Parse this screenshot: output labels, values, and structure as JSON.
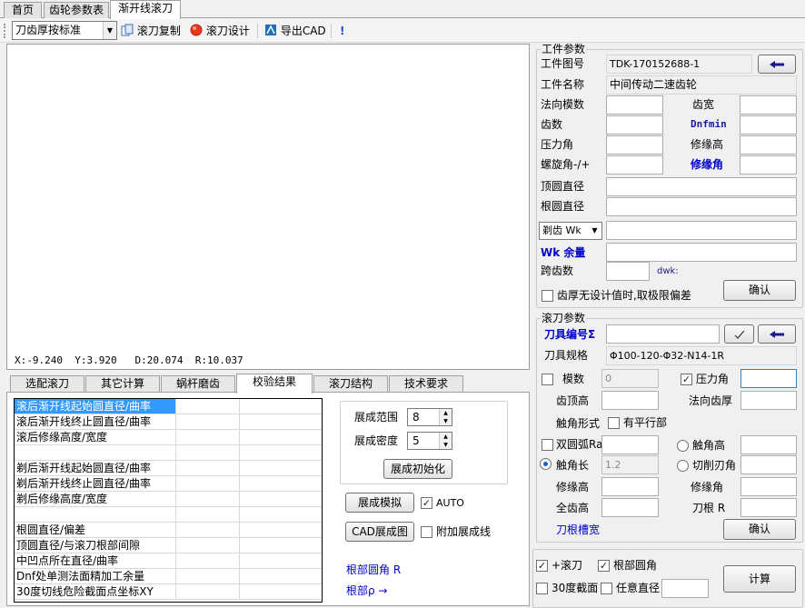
{
  "tabs": {
    "home": "首页",
    "gear_table": "齿轮参数表",
    "hob": "渐开线滚刀"
  },
  "toolbar": {
    "mode": "刀齿厚按标准",
    "copy": "滚刀复制",
    "design": "滚刀设计",
    "export": "导出CAD",
    "mark": "!"
  },
  "canvas": {
    "x": "X:-9.240",
    "y": "Y:3.920",
    "d": "D:20.074",
    "r": "R:10.037"
  },
  "bottom_tabs": [
    "选配滚刀",
    "其它计算",
    "蜗杆磨齿",
    "校验结果",
    "滚刀结构",
    "技术要求"
  ],
  "results_rows": [
    "滚后渐开线起始圆直径/曲率",
    "滚后渐开线终止圆直径/曲率",
    "滚后修缘高度/宽度",
    "",
    "剃后渐开线起始圆直径/曲率",
    "剃后渐开线终止圆直径/曲率",
    "剃后修缘高度/宽度",
    "",
    "根圆直径/偏差",
    "顶圆直径/与滚刀根部间隙",
    "中凹点所在直径/曲率",
    "Dnf处单测法面精加工余量",
    "30度切线危险截面点坐标XY"
  ],
  "expand": {
    "range_label": "展成范围",
    "range_value": "8",
    "density_label": "展成密度",
    "density_value": "5",
    "init_btn": "展成初始化",
    "sim_btn": "展成模拟",
    "auto_label": "AUTO",
    "cad_btn": "CAD展成图",
    "extra_label": "附加展成线",
    "root_fillet_label": "根部圆角 R",
    "root_rho_label": "根部ρ →"
  },
  "workpiece": {
    "title": "工件参数",
    "drawing_no_label": "工件图号",
    "drawing_no": "TDK-170152688-1",
    "name_label": "工件名称",
    "name": "中间传动二速齿轮",
    "normal_module": "法向模数",
    "face_width": "齿宽",
    "teeth": "齿数",
    "dnfmin": "Dnfmin",
    "pressure_angle": "压力角",
    "tip_relief_height": "修缘高",
    "helix_angle": "螺旋角-/+",
    "tip_relief_angle": "修缘角",
    "tip_dia": "顶圆直径",
    "root_dia": "根圆直径",
    "shave_select": "剃齿 Wk",
    "wk_allow": "Wk 余量",
    "span": "跨齿数",
    "dwk": "dwk:",
    "limit_label": "齿厚无设计值时,取极限偏差",
    "confirm": "确认"
  },
  "hob": {
    "title": "滚刀参数",
    "tool_no_label": "刀具编号Σ",
    "spec_label": "刀具规格",
    "spec": "Φ100-120-Φ32-N14-1R",
    "module_label": "模数",
    "module_value": "0",
    "pa_label": "压力角",
    "addendum": "齿顶高",
    "normal_thick": "法向齿厚",
    "corner_shape": "触角形式",
    "flat_label": "有平行部",
    "double_arc": "双圆弧Ra",
    "corner_height": "触角高",
    "corner_length": "触角长",
    "corner_length_value": "1.2",
    "cut_edge": "切削刃角",
    "relief_height": "修缘高",
    "relief_angle": "修缘角",
    "full_height": "全齿高",
    "root_r": "刀根 R",
    "groove": "刀根槽宽",
    "confirm": "确认"
  },
  "options": {
    "plus_hob": "+滚刀",
    "root_fillet": "根部圆角",
    "section30": "30度截面",
    "any_dia": "任意直径",
    "calc": "计算"
  }
}
